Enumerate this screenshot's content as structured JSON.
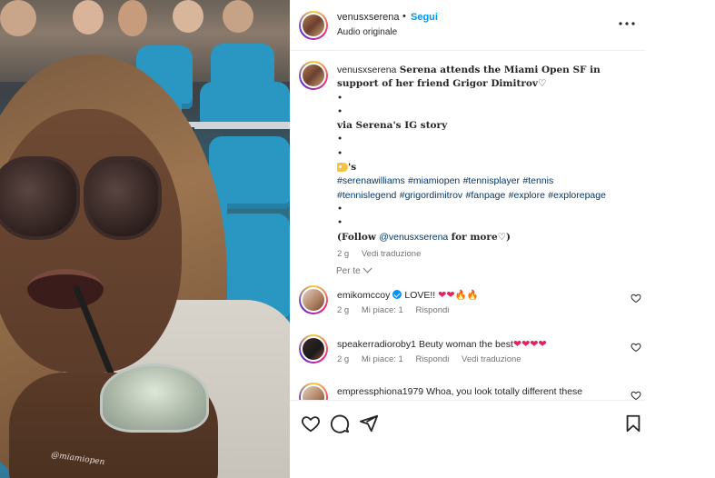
{
  "post": {
    "username": "venusxserena",
    "follow_label": "Segui",
    "audio_label": "Audio originale",
    "more_icon": "more-horizontal-icon"
  },
  "caption": {
    "username": "venusxserena",
    "headline": "Serena attends the Miami Open SF in support of her friend Grigor Dimitrov♡",
    "bullet": "•",
    "via": "via Serena's IG story",
    "label_suffix": "'s",
    "hashtags_line1": [
      "#serenawilliams",
      "#miamiopen",
      "#tennisplayer",
      "#tennis"
    ],
    "hashtags_line2": [
      "#tennislegend",
      "#grigordimitrov",
      "#fanpage",
      "#explore",
      "#explorepage"
    ],
    "follow_prefix": "(Follow",
    "follow_mention": "@venusxserena",
    "follow_suffix": "for more♡)",
    "time": "2 g",
    "translate": "Vedi traduzione"
  },
  "for_you": "Per te",
  "comments": [
    {
      "username": "emikomccoy",
      "verified": true,
      "text": "LOVE!!",
      "emoji_hearts": "❤❤",
      "emoji_fire": "🔥🔥",
      "time": "2 g",
      "likes": "Mi piace: 1",
      "reply": "Rispondi",
      "translate": ""
    },
    {
      "username": "speakerradioroby1",
      "verified": false,
      "text": "Beuty woman the best",
      "emoji_hearts": "❤❤❤❤",
      "emoji_fire": "",
      "time": "2 g",
      "likes": "Mi piace: 1",
      "reply": "Rispondi",
      "translate": "Vedi traduzione"
    },
    {
      "username": "empressphiona1979",
      "verified": false,
      "text": "Whoa, you look totally different these",
      "emoji_hearts": "",
      "emoji_fire": "",
      "time": "",
      "likes": "",
      "reply": "",
      "translate": ""
    }
  ],
  "watermark": "@miamiopen",
  "actions": [
    "heart-icon",
    "comment-icon",
    "share-icon",
    "bookmark-icon"
  ],
  "colors": {
    "link": "#00376b",
    "follow": "#0095f6",
    "like_red": "#e0245e",
    "muted": "#737373"
  }
}
